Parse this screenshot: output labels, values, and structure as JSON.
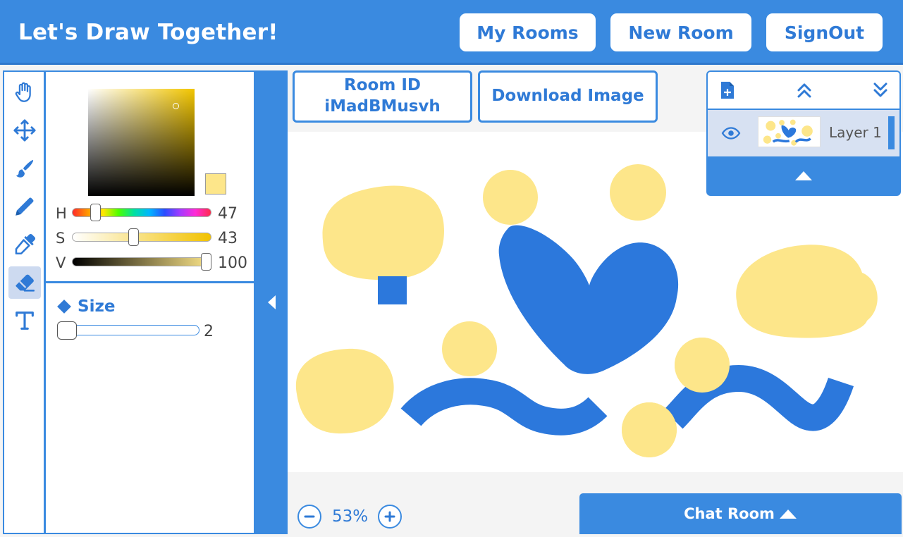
{
  "header": {
    "title": "Let's Draw Together!",
    "my_rooms": "My Rooms",
    "new_room": "New Room",
    "sign_out": "SignOut"
  },
  "tools": [
    {
      "icon": "hand-icon",
      "active": false
    },
    {
      "icon": "move-icon",
      "active": false
    },
    {
      "icon": "brush-icon",
      "active": false
    },
    {
      "icon": "pencil-icon",
      "active": false
    },
    {
      "icon": "eyedropper-icon",
      "active": false
    },
    {
      "icon": "eraser-icon",
      "active": true
    },
    {
      "icon": "text-icon",
      "active": false
    }
  ],
  "color_picker": {
    "h_label": "H",
    "h_value": "47",
    "s_label": "S",
    "s_value": "43",
    "v_label": "V",
    "v_value": "100",
    "current_color": "#fde68a"
  },
  "size": {
    "label": "Size",
    "value": "2"
  },
  "room": {
    "id_label": "Room ID",
    "id_value": "iMadBMusvh"
  },
  "download_label": "Download Image",
  "layers": {
    "items": [
      {
        "name": "Layer 1",
        "visible": true
      }
    ]
  },
  "zoom": {
    "value": "53%"
  },
  "chat_label": "Chat Room",
  "colors": {
    "accent": "#3a8ae0",
    "stroke_blue": "#2c78dc",
    "blob_yellow": "#fde68a"
  }
}
